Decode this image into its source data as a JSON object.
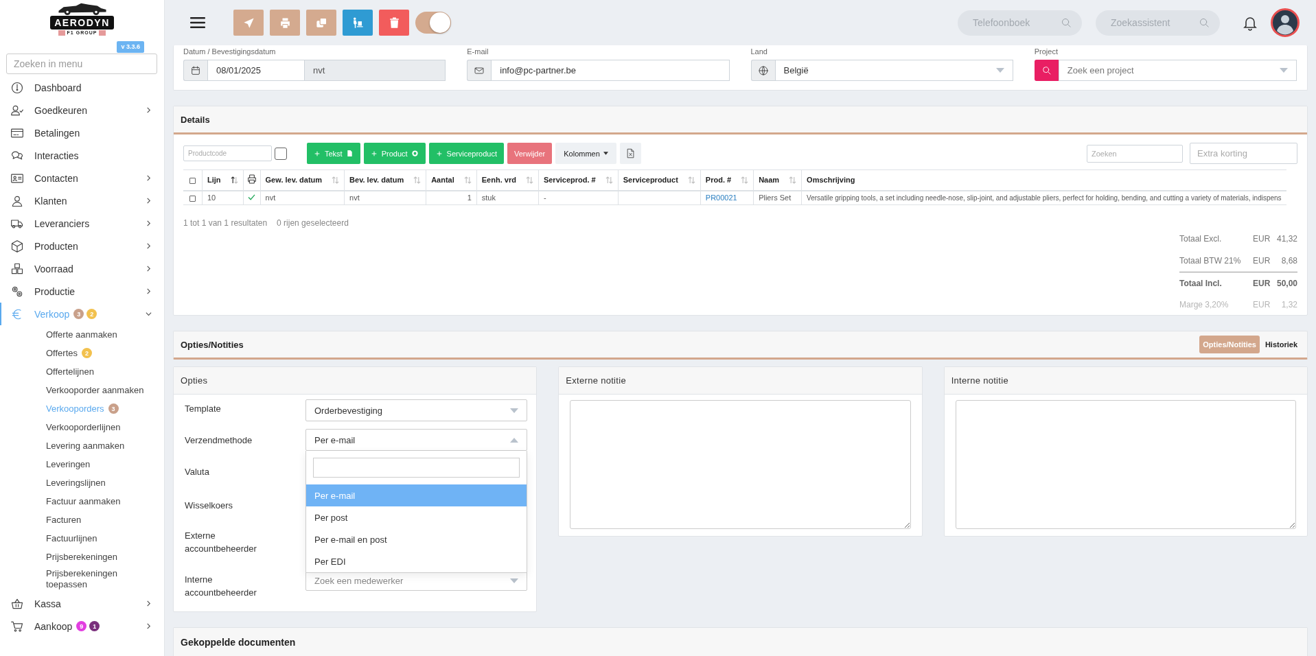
{
  "sidebar": {
    "logo": {
      "name": "AERODYN",
      "subtitle": "F1 GROUP"
    },
    "version": "v 3.3.6",
    "search": {
      "placeholder": "Zoeken in menu"
    },
    "items": [
      {
        "kind": "link",
        "label": "Dashboard",
        "selected": false
      },
      {
        "kind": "group",
        "label": "Goedkeuren",
        "selected": false,
        "expanded": false
      },
      {
        "kind": "link",
        "label": "Betalingen",
        "selected": false
      },
      {
        "kind": "link",
        "label": "Interacties",
        "selected": false
      },
      {
        "kind": "group",
        "label": "Contacten",
        "selected": false,
        "expanded": false
      },
      {
        "kind": "group",
        "label": "Klanten",
        "selected": false,
        "expanded": false
      },
      {
        "kind": "group",
        "label": "Leveranciers",
        "selected": false,
        "expanded": false
      },
      {
        "kind": "group",
        "label": "Producten",
        "selected": false,
        "expanded": false
      },
      {
        "kind": "group",
        "label": "Voorraad",
        "selected": false,
        "expanded": false
      },
      {
        "kind": "group",
        "label": "Productie",
        "selected": false,
        "expanded": false
      },
      {
        "kind": "group",
        "label": "Verkoop",
        "selected": true,
        "expanded": true,
        "badges": [
          {
            "text": "3",
            "color": "#c9a08a"
          },
          {
            "text": "2",
            "color": "#f2c14e"
          }
        ],
        "children": [
          {
            "label": "Offerte aanmaken",
            "selected": false
          },
          {
            "label": "Offertes",
            "selected": false,
            "badges": [
              {
                "text": "2",
                "color": "#f2c14e"
              }
            ]
          },
          {
            "label": "Offertelijnen",
            "selected": false
          },
          {
            "label": "Verkooporder aanmaken",
            "selected": false
          },
          {
            "label": "Verkooporders",
            "selected": true,
            "badges": [
              {
                "text": "3",
                "color": "#c9a08a"
              }
            ]
          },
          {
            "label": "Verkooporderlijnen",
            "selected": false
          },
          {
            "label": "Levering aanmaken",
            "selected": false
          },
          {
            "label": "Leveringen",
            "selected": false
          },
          {
            "label": "Leveringslijnen",
            "selected": false
          },
          {
            "label": "Factuur aanmaken",
            "selected": false
          },
          {
            "label": "Facturen",
            "selected": false
          },
          {
            "label": "Factuurlijnen",
            "selected": false
          },
          {
            "label": "Prijsberekeningen",
            "selected": false
          },
          {
            "label": "Prijsberekeningen toepassen",
            "selected": false
          }
        ]
      },
      {
        "kind": "group",
        "label": "Kassa",
        "selected": false,
        "expanded": false
      },
      {
        "kind": "group",
        "label": "Aankoop",
        "selected": false,
        "expanded": false,
        "badges": [
          {
            "text": "9",
            "color": "#e23ee0"
          },
          {
            "text": "1",
            "color": "#7a2f7c"
          }
        ]
      }
    ]
  },
  "topbar": {
    "actions": [
      {
        "color": "#d4aa8f"
      },
      {
        "color": "#d4aa8f"
      },
      {
        "color": "#d4aa8f"
      },
      {
        "color": "#2f9bd3"
      },
      {
        "color": "#f25c5c"
      }
    ],
    "toggle": {
      "on": true
    },
    "searches": [
      {
        "placeholder": "Telefoonboek"
      },
      {
        "placeholder": "Zoekassistent"
      }
    ]
  },
  "header_form": {
    "fields": [
      {
        "kind": "date",
        "label": "Datum / Bevestigingsdatum",
        "value": "08/01/2025",
        "secondary": "nvt"
      },
      {
        "kind": "email",
        "label": "E-mail",
        "value": "info@pc-partner.be"
      },
      {
        "kind": "country",
        "label": "Land",
        "value": "België"
      },
      {
        "kind": "project",
        "label": "Project",
        "placeholder": "Zoek een project"
      }
    ]
  },
  "details": {
    "title": "Details",
    "product_code": {
      "placeholder": "Productcode"
    },
    "quick_checked": false,
    "buttons": [
      {
        "kind": "add_text",
        "label": "Tekst"
      },
      {
        "kind": "add_product",
        "label": "Product"
      },
      {
        "kind": "add_service",
        "label": "Serviceproduct"
      },
      {
        "kind": "delete",
        "label": "Verwijder"
      },
      {
        "kind": "columns",
        "label": "Kolommen"
      },
      {
        "kind": "export"
      }
    ],
    "search": {
      "placeholder": "Zoeken"
    },
    "discount": {
      "placeholder": "Extra korting"
    },
    "columns": [
      {
        "kind": "checkbox",
        "checked": false
      },
      {
        "kind": "text",
        "label": "Lijn",
        "sorted": true
      },
      {
        "kind": "print"
      },
      {
        "kind": "text",
        "label": "Gew. lev. datum",
        "sorted": false
      },
      {
        "kind": "text",
        "label": "Bev. lev. datum",
        "sorted": false
      },
      {
        "kind": "number",
        "label": "Aantal",
        "sorted": false
      },
      {
        "kind": "text",
        "label": "Eenh. vrd",
        "sorted": false
      },
      {
        "kind": "text",
        "label": "Serviceprod. #",
        "sorted": false
      },
      {
        "kind": "text",
        "label": "Serviceproduct",
        "sorted": false
      },
      {
        "kind": "link",
        "label": "Prod. #",
        "sorted": false
      },
      {
        "kind": "text",
        "label": "Naam",
        "sorted": false
      },
      {
        "kind": "text",
        "label": "Omschrijving"
      }
    ],
    "rows": [
      {
        "cells": [
          {
            "checked": false
          },
          "10",
          {
            "checked": true
          },
          "nvt",
          "nvt",
          "1",
          "stuk",
          "-",
          "",
          "PR00021",
          "Pliers Set",
          "Versatile gripping tools, a set including needle-nose, slip-joint, and adjustable pliers, perfect for holding, bending, and cutting a variety of materials, indispens"
        ]
      }
    ],
    "result_count": "1 tot 1 van 1 resultaten",
    "selected_count": "0 rijen geselecteerd",
    "totals": [
      {
        "kind": "normal",
        "label": "Totaal Excl.",
        "currency": "EUR",
        "amount": "41,32"
      },
      {
        "kind": "normal",
        "label": "Totaal BTW 21%",
        "currency": "EUR",
        "amount": "8,68"
      },
      {
        "kind": "total",
        "label": "Totaal Incl.",
        "currency": "EUR",
        "amount": "50,00"
      },
      {
        "kind": "muted",
        "label": "Marge 3,20%",
        "currency": "EUR",
        "amount": "1,32"
      }
    ]
  },
  "notes_bar": {
    "title": "Opties/Notities",
    "tabs": [
      {
        "label": "Opties/Notities",
        "selected": true
      },
      {
        "label": "Historiek",
        "selected": false
      }
    ]
  },
  "options": {
    "title": "Opties",
    "fields": [
      {
        "label": "Template",
        "value": "Orderbevestiging"
      },
      {
        "label": "Verzendmethode",
        "value": "Per e-mail",
        "open": true,
        "dropdown": {
          "options": [
            {
              "label": "Per e-mail",
              "selected": true
            },
            {
              "label": "Per post",
              "selected": false
            },
            {
              "label": "Per e-mail en post",
              "selected": false
            },
            {
              "label": "Per EDI",
              "selected": false
            }
          ]
        }
      },
      {
        "label": "Valuta"
      },
      {
        "label": "Wisselkoers"
      },
      {
        "label": "Externe accountbeheerder"
      },
      {
        "label": "Interne accountbeheerder",
        "placeholder": "Zoek een medewerker"
      }
    ]
  },
  "notes": [
    {
      "title": "Externe notitie"
    },
    {
      "title": "Interne notitie"
    }
  ],
  "linked_documents": {
    "title": "Gekoppelde documenten"
  }
}
